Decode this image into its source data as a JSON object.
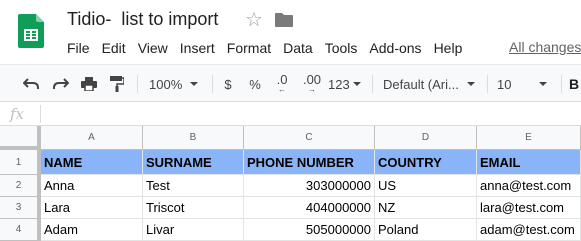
{
  "title": {
    "doc_name": "Tidio-  list to import"
  },
  "menu": [
    "File",
    "Edit",
    "View",
    "Insert",
    "Format",
    "Data",
    "Tools",
    "Add-ons",
    "Help"
  ],
  "changes_link": "All changes",
  "toolbar": {
    "zoom": "100%",
    "currency": "$",
    "percent": "%",
    "dec_decrease": ".0",
    "dec_increase": ".00",
    "more_formats": "123",
    "font": "Default (Ari...",
    "font_size": "10",
    "bold": "B"
  },
  "formula_bar": {
    "fx_label": "fx"
  },
  "sheet": {
    "columns": [
      "A",
      "B",
      "C",
      "D",
      "E"
    ],
    "rows": [
      "1",
      "2",
      "3",
      "4"
    ],
    "cells": [
      [
        "NAME",
        "SURNAME",
        "PHONE NUMBER",
        "COUNTRY",
        "EMAIL"
      ],
      [
        "Anna",
        "Test",
        "303000000",
        "US",
        "anna@test.com"
      ],
      [
        "Lara",
        "Triscot",
        "404000000",
        "NZ",
        "lara@test.com"
      ],
      [
        "Adam",
        "Livar",
        "505000000",
        "Poland",
        "adam@test.com"
      ]
    ]
  },
  "colors": {
    "header_fill": "#8ab4f8",
    "sheets_green": "#0f9d58"
  }
}
